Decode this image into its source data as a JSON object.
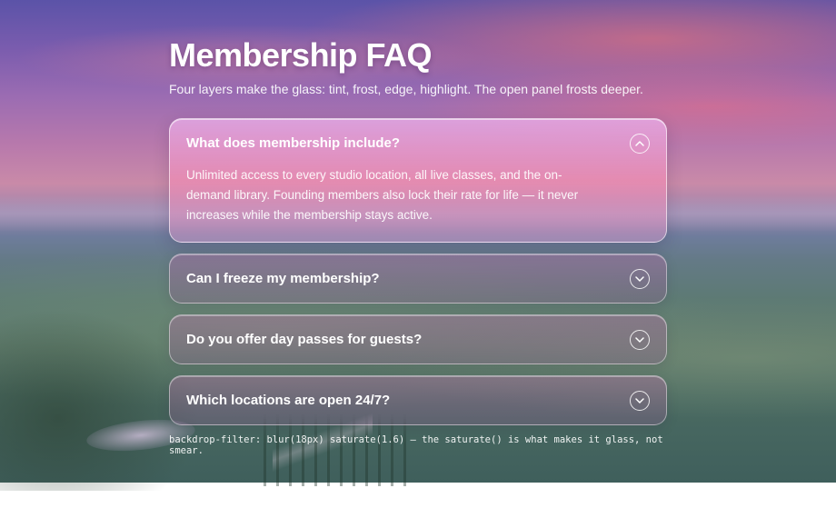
{
  "header": {
    "title": "Membership FAQ",
    "subtitle": "Four layers make the glass: tint, frost, edge, highlight. The open panel frosts deeper."
  },
  "faq": {
    "items": [
      {
        "question": "What does membership include?",
        "answer": "Unlimited access to every studio location, all live classes, and the on-demand library. Founding members also lock their rate for life — it never increases while the membership stays active.",
        "expanded": true
      },
      {
        "question": "Can I freeze my membership?",
        "expanded": false
      },
      {
        "question": "Do you offer day passes for guests?",
        "expanded": false
      },
      {
        "question": "Which locations are open 24/7?",
        "expanded": false
      }
    ]
  },
  "footer_note": "backdrop-filter: blur(18px) saturate(1.6) — the saturate() is what makes it glass, not smear.",
  "icons": {
    "expanded": "chevron-up-icon",
    "collapsed": "chevron-down-icon"
  },
  "colors": {
    "text": "#ffffff",
    "open_panel_tint": "#e6a6e0",
    "closed_panel_tint": "#b46ea8"
  }
}
